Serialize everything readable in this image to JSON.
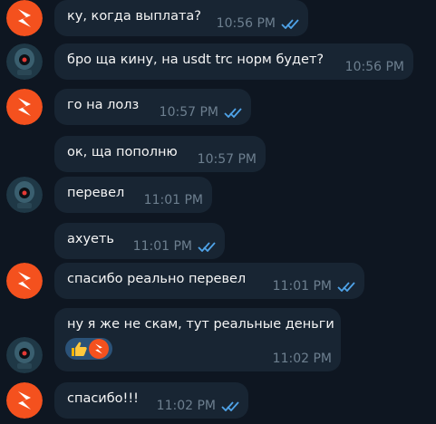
{
  "chat": {
    "messages": [
      {
        "sender": "user1",
        "text": "ку, когда выплата?",
        "time": "10:56 PM",
        "status": "read"
      },
      {
        "sender": "user2",
        "text": "бро ща кину, на usdt trc норм будет?",
        "time": "10:56 PM"
      },
      {
        "sender": "user1",
        "text": "го на лолз",
        "time": "10:57 PM",
        "status": "read"
      },
      {
        "sender": "user2",
        "text": "ок, ща пополню",
        "time": "10:57 PM"
      },
      {
        "sender": "user2",
        "text": "перевел",
        "time": "11:01 PM"
      },
      {
        "sender": "user1",
        "text": "ахуеть",
        "time": "11:01 PM",
        "status": "read"
      },
      {
        "sender": "user1",
        "text": "спасибо реально перевел",
        "time": "11:01 PM",
        "status": "read"
      },
      {
        "sender": "user2",
        "text": "ну я же не скам, тут реальные деньги",
        "time": "11:02 PM",
        "reactions": [
          "thumbs-up",
          "lightning-avatar"
        ]
      },
      {
        "sender": "user1",
        "text": "спасибо!!!",
        "time": "11:02 PM",
        "status": "read"
      }
    ]
  },
  "colors": {
    "background": "#0e1621",
    "bubble": "#182533",
    "text": "#f5f5f5",
    "time": "#6d7f8f",
    "ticks": "#4fa3e8",
    "avatar_orange": "#f4511e",
    "avatar_dark": "#1f3846",
    "reaction_bg": "#2b5278"
  }
}
